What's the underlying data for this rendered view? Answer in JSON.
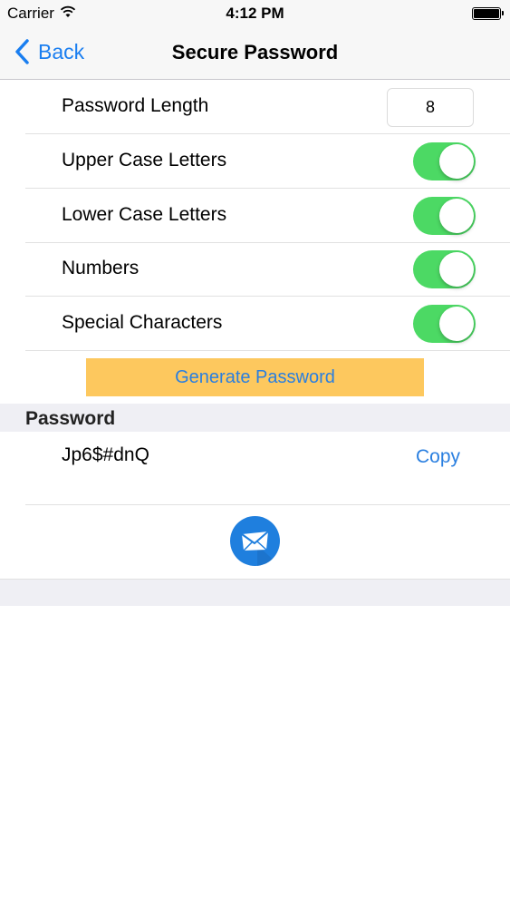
{
  "status_bar": {
    "carrier": "Carrier",
    "time": "4:12 PM",
    "icons": [
      "wifi-icon",
      "battery-icon"
    ]
  },
  "nav": {
    "back_label": "Back",
    "title": "Secure Password"
  },
  "settings": {
    "length_label": "Password Length",
    "length_value": "8",
    "toggles": [
      {
        "label": "Upper Case Letters",
        "on": true
      },
      {
        "label": "Lower Case Letters",
        "on": true
      },
      {
        "label": "Numbers",
        "on": true
      },
      {
        "label": "Special Characters",
        "on": true
      }
    ]
  },
  "generate_label": "Generate Password",
  "result": {
    "section_title": "Password",
    "password": "Jp6$#dnQ",
    "copy_label": "Copy"
  },
  "colors": {
    "accent": "#1a7ef0",
    "toggle_on": "#4cd964",
    "generate_button_bg": "#fdc85e",
    "mail_button_bg": "#1f7fde"
  }
}
